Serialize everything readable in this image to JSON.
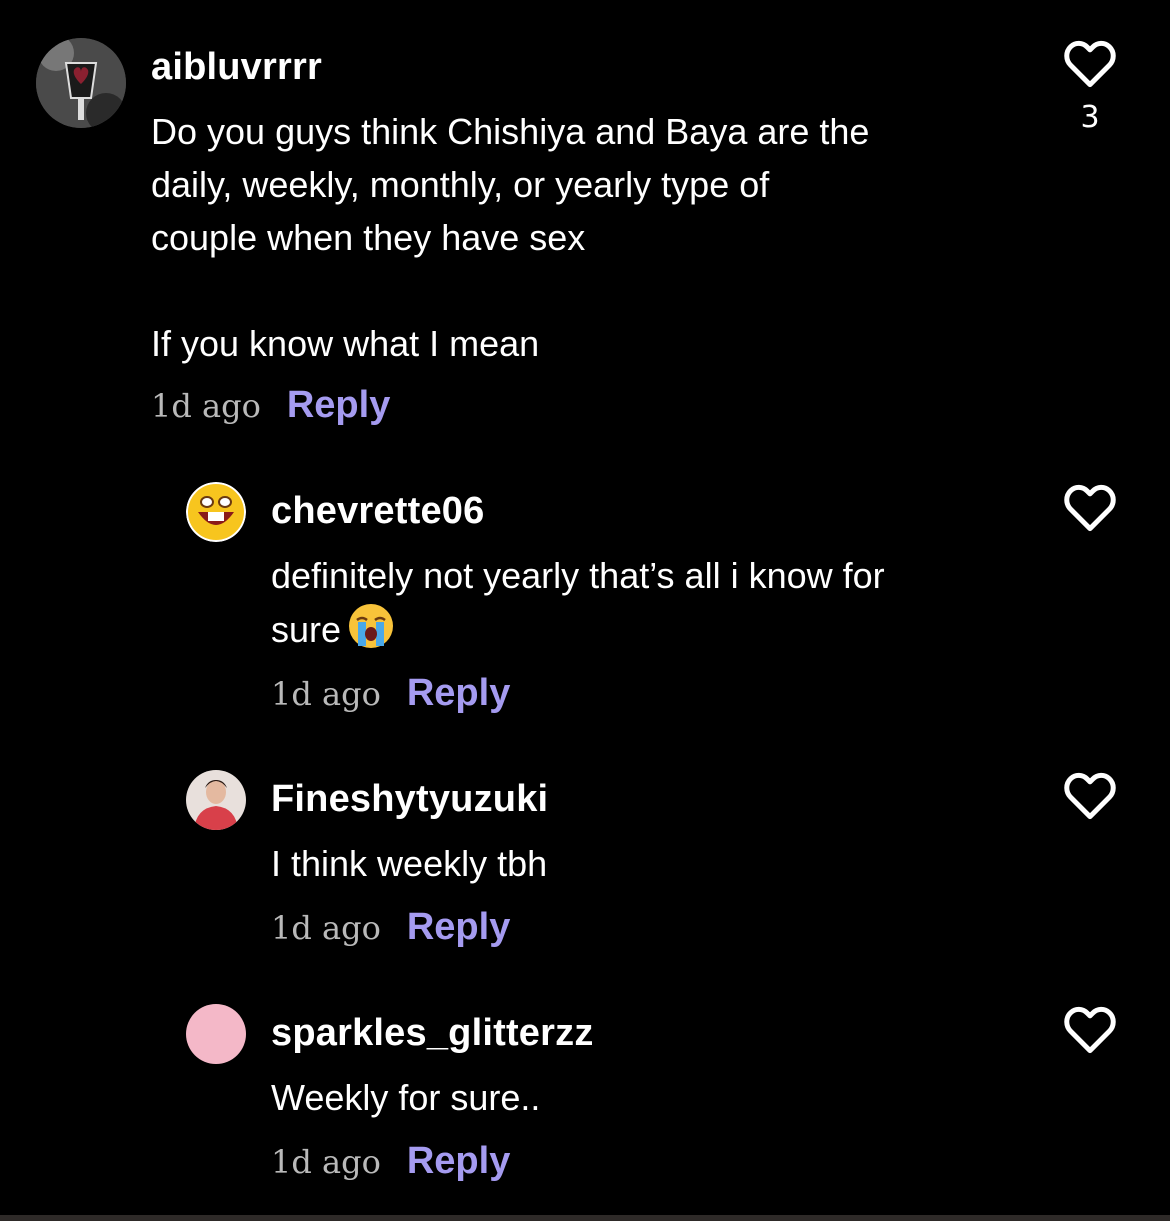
{
  "comments": [
    {
      "username": "aibluvrrrr",
      "text_lines": [
        "Do you guys think Chishiya and Baya are the",
        "daily, weekly, monthly, or yearly type of",
        "couple when they have sex",
        "",
        "If you know what I mean"
      ],
      "time": "1d ago",
      "reply_label": "Reply",
      "likes": "3",
      "avatar": "dark-lamp-avatar"
    },
    {
      "username": "chevrette06",
      "text_lines": [
        "definitely not yearly that’s all i know for",
        "sure"
      ],
      "emoji": "crying-face",
      "time": "1d ago",
      "reply_label": "Reply",
      "avatar": "laughing-emoji-avatar"
    },
    {
      "username": "Fineshytyuzuki",
      "text_lines": [
        "I think weekly tbh"
      ],
      "time": "1d ago",
      "reply_label": "Reply",
      "avatar": "person-red-shirt-avatar"
    },
    {
      "username": "sparkles_glitterzz",
      "text_lines": [
        "Weekly for sure.."
      ],
      "time": "1d ago",
      "reply_label": "Reply",
      "avatar": "pink-circle-avatar"
    }
  ],
  "colors": {
    "background": "#000000",
    "reply": "#a59bf0",
    "time": "#b9b9b9",
    "pink_avatar": "#f4b8c8"
  }
}
